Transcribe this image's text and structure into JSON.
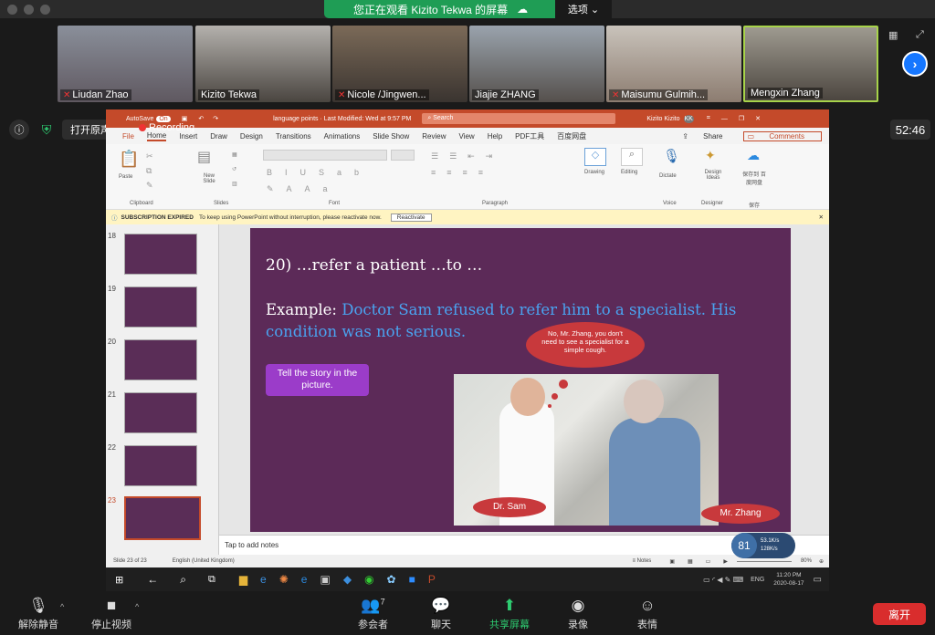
{
  "top": {
    "viewing_text": "您正在观看 Kizito Tekwa 的屏幕",
    "options_label": "选项"
  },
  "participants": [
    {
      "name": "Liudan Zhao",
      "muted": true
    },
    {
      "name": "Kizito Tekwa",
      "muted": false
    },
    {
      "name": "Nicole /Jingwen...",
      "muted": true
    },
    {
      "name": "Jiajie ZHANG",
      "muted": false
    },
    {
      "name": "Maisumu Gulmih...",
      "muted": true
    },
    {
      "name": "Mengxin Zhang",
      "muted": false
    }
  ],
  "left_controls": {
    "original_sound": "打开原声",
    "recording": "Recording",
    "timer": "52:46"
  },
  "ppt": {
    "autosave": "AutoSave",
    "autosave_state": "On",
    "doc_title": "language points · Last Modified: Wed at 9:57 PM",
    "search": "Search",
    "user": "Kizito Kizito",
    "user_initials": "KK",
    "tabs": [
      "File",
      "Home",
      "Insert",
      "Draw",
      "Design",
      "Transitions",
      "Animations",
      "Slide Show",
      "Review",
      "View",
      "Help",
      "PDF工具",
      "百度网盘"
    ],
    "share": "Share",
    "comments": "Comments",
    "ribbon": {
      "paste": "Paste",
      "clipboard": "Clipboard",
      "new_slide": "New Slide",
      "slides": "Slides",
      "font": "Font",
      "paragraph": "Paragraph",
      "drawing": "Drawing",
      "editing": "Editing",
      "dictate": "Dictate",
      "voice": "Voice",
      "design_ideas": "Design Ideas",
      "designer": "Designer",
      "save_baidu": "保存到 百度网盘",
      "save": "保存"
    },
    "subscription": {
      "label": "SUBSCRIPTION EXPIRED",
      "text": "To keep using PowerPoint without interruption, please reactivate now.",
      "button": "Reactivate"
    },
    "thumb_numbers": [
      "18",
      "19",
      "20",
      "21",
      "22",
      "23"
    ],
    "slide": {
      "title": "20) …refer a patient …to …",
      "example_label": "Example:",
      "example_text": "Doctor Sam refused to refer him to a specialist. His condition was not serious.",
      "task": "Tell the story in the picture.",
      "bubble": "No, Mr. Zhang, you don't need to see a specialist for a simple cough.",
      "label_doctor": "Dr. Sam",
      "label_patient": "Mr. Zhang"
    },
    "notes_placeholder": "Tap to add notes",
    "status": {
      "slide": "Slide 23 of 23",
      "language": "English (United Kingdom)",
      "notes": "Notes",
      "zoom": "80%"
    },
    "net": {
      "percent": "81",
      "up": "53.1K/s",
      "down": "128K/s"
    },
    "clock": {
      "time": "11:20 PM",
      "date": "2020-08-17",
      "lang": "ENG"
    }
  },
  "bottom": {
    "unmute": "解除静音",
    "stop_video": "停止视频",
    "participants": "参会者",
    "participants_count": "7",
    "chat": "聊天",
    "share": "共享屏幕",
    "record": "录像",
    "reactions": "表情",
    "leave": "离开"
  },
  "colors": {
    "ppt_red": "#c44a2a",
    "slide_bg": "#5c2a58",
    "slide_blue": "#4aa3f0",
    "purple_btn": "#9b3cc9",
    "bubble_red": "#c8393c",
    "zoom_green": "#1f9d55",
    "leave_red": "#d92d2d"
  }
}
